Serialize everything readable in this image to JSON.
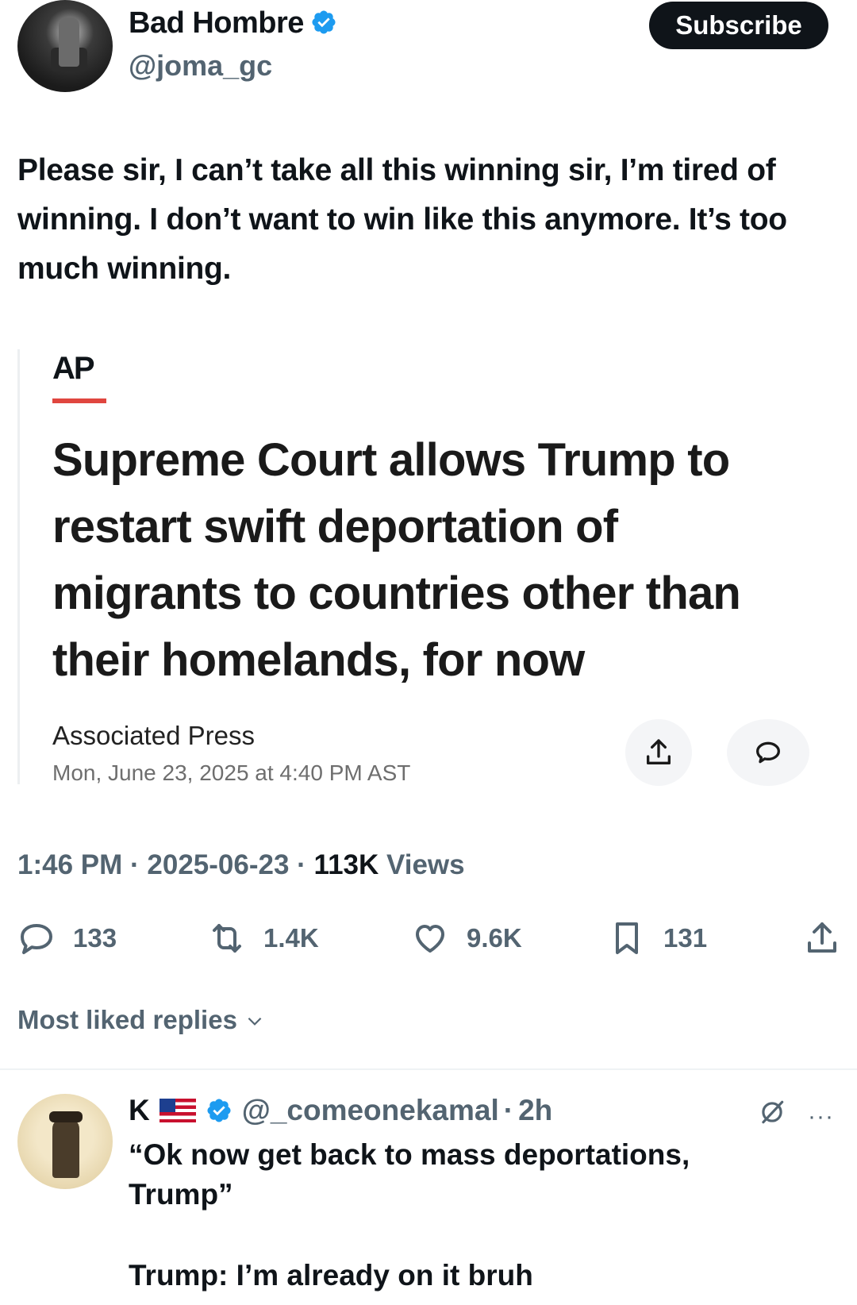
{
  "author": {
    "display_name": "Bad Hombre",
    "handle": "@joma_gc",
    "verified": true
  },
  "subscribe_label": "Subscribe",
  "tweet_text": "Please sir, I can’t take all this winning sir, I’m tired of winning. I don’t want to win like this anymore. It’s too much winning.",
  "card": {
    "logo": "AP",
    "headline": "Supreme Court allows Trump to restart swift deportation of migrants to countries other than their homelands, for now",
    "source": "Associated Press",
    "date": "Mon, June 23, 2025 at 4:40 PM AST"
  },
  "meta": {
    "time": "1:46 PM",
    "date": "2025-06-23",
    "views_count": "113K",
    "views_label": "Views"
  },
  "actions": {
    "replies": "133",
    "reposts": "1.4K",
    "likes": "9.6K",
    "bookmarks": "131"
  },
  "replies_sort": "Most liked replies",
  "reply": {
    "name": "K",
    "handle": "@_comeonekamal",
    "time": "2h",
    "text": "“Ok now get back to mass deportations, Trump”",
    "text2": "Trump: I’m already on it bruh",
    "more": "···"
  },
  "colors": {
    "text": "#0f1419",
    "secondary": "#536471",
    "verified_blue": "#1d9bf0",
    "ap_red": "#e0463f"
  },
  "icons": [
    "verified-badge-icon",
    "share-icon",
    "comment-icon",
    "reply-icon",
    "repost-icon",
    "like-icon",
    "bookmark-icon",
    "chevron-down-icon",
    "grok-icon",
    "more-icon"
  ]
}
